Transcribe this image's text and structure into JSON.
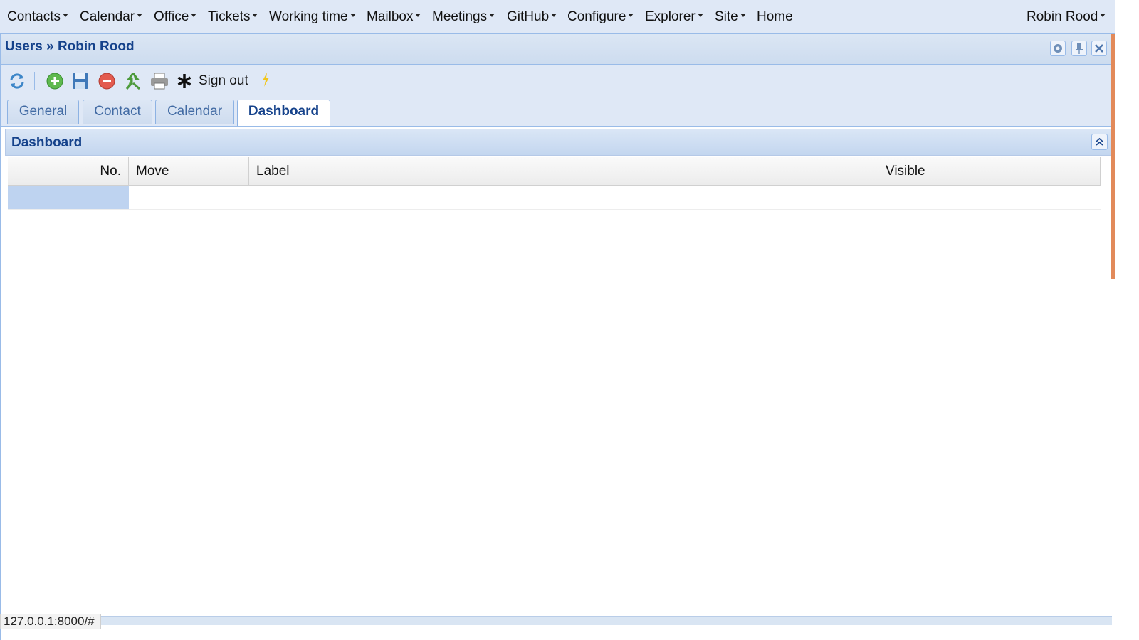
{
  "topnav": {
    "menus": [
      {
        "label": "Contacts"
      },
      {
        "label": "Calendar"
      },
      {
        "label": "Office"
      },
      {
        "label": "Tickets"
      },
      {
        "label": "Working time"
      },
      {
        "label": "Mailbox"
      },
      {
        "label": "Meetings"
      },
      {
        "label": "GitHub"
      },
      {
        "label": "Configure"
      },
      {
        "label": "Explorer"
      },
      {
        "label": "Site"
      }
    ],
    "home": "Home",
    "user": "Robin Rood"
  },
  "window": {
    "title": "Users » Robin Rood",
    "tools": [
      "gear-icon",
      "pin-icon",
      "close-icon"
    ]
  },
  "toolbar": {
    "icons": [
      "refresh-icon",
      "add-icon",
      "save-icon",
      "delete-icon",
      "merge-icon",
      "print-icon",
      "asterisk-icon",
      "lightning-icon"
    ],
    "signout_label": "Sign out"
  },
  "tabs": [
    {
      "label": "General",
      "active": false
    },
    {
      "label": "Contact",
      "active": false
    },
    {
      "label": "Calendar",
      "active": false
    },
    {
      "label": "Dashboard",
      "active": true
    }
  ],
  "panel": {
    "title": "Dashboard",
    "columns": [
      "No.",
      "Move",
      "Label",
      "Visible"
    ],
    "rows": []
  },
  "status": {
    "url": "127.0.0.1:8000/#"
  },
  "colors": {
    "header_bg": "#dfe8f6",
    "title_blue": "#15428b",
    "border_blue": "#99bbe8",
    "selection": "#bed3f0"
  }
}
